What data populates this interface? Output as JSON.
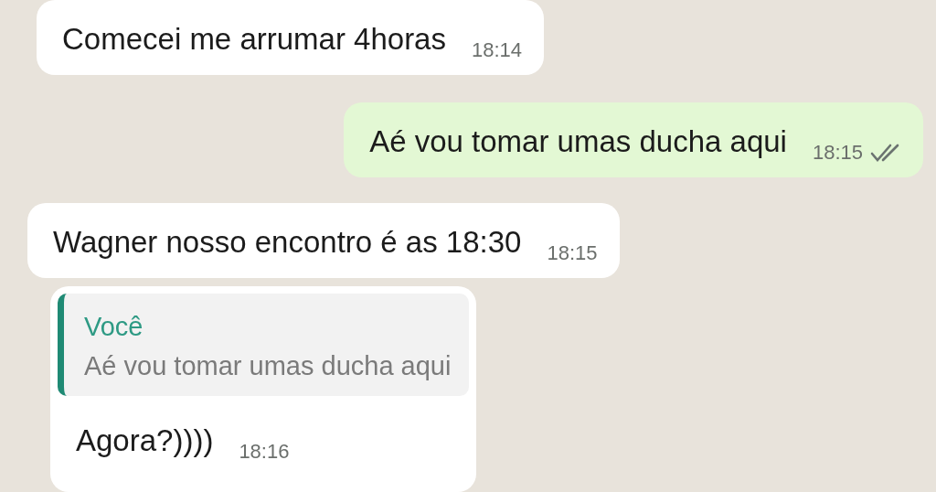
{
  "messages": [
    {
      "kind": "incoming",
      "text": "Comecei me arrumar 4horas",
      "time": "18:14"
    },
    {
      "kind": "outgoing",
      "text": "Aé vou tomar umas ducha aqui",
      "time": "18:15",
      "read": true
    },
    {
      "kind": "incoming",
      "text": "Wagner nosso encontro é as 18:30",
      "time": "18:15"
    },
    {
      "kind": "incoming",
      "text": "Agora?))))",
      "time": "18:16",
      "quote": {
        "author": "Você",
        "text": "Aé vou tomar umas ducha aqui"
      }
    }
  ]
}
